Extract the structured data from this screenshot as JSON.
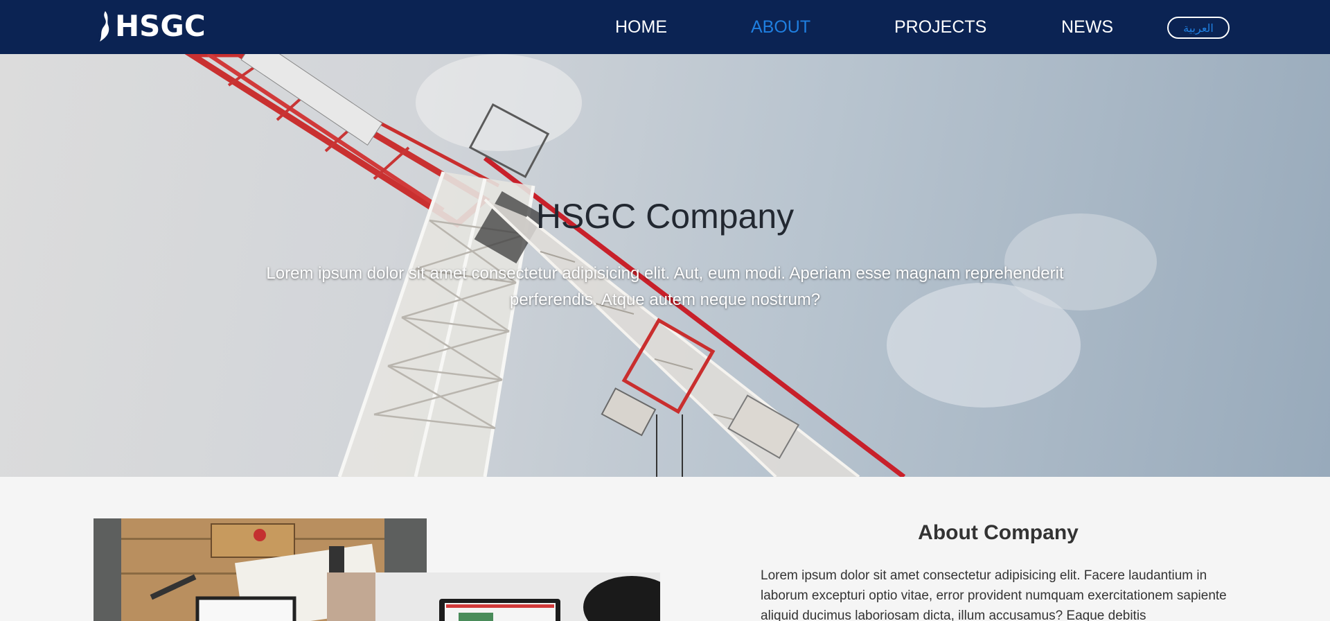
{
  "navbar": {
    "logo_text": "HSGC",
    "links": [
      {
        "label": "HOME",
        "active": false
      },
      {
        "label": "ABOUT",
        "active": true
      },
      {
        "label": "PROJECTS",
        "active": false
      },
      {
        "label": "NEWS",
        "active": false
      }
    ],
    "language_button": "العربية"
  },
  "hero": {
    "title": "HSGC Company",
    "text": "Lorem ipsum dolor sit amet consectetur adipisicing elit. Aut, eum modi. Aperiam esse magnam reprehenderit perferendis. Atque autem neque nostrum?"
  },
  "about": {
    "title": "About Company",
    "text": "Lorem ipsum dolor sit amet consectetur adipisicing elit. Facere laudantium in laborum excepturi optio vitae, error provident numquam exercitationem sapiente aliquid ducimus laboriosam dicta, illum accusamus? Eaque debitis"
  },
  "colors": {
    "navbar": "#0b2353",
    "active_link": "#1f7fe0",
    "page_background": "#f5f5f5"
  }
}
